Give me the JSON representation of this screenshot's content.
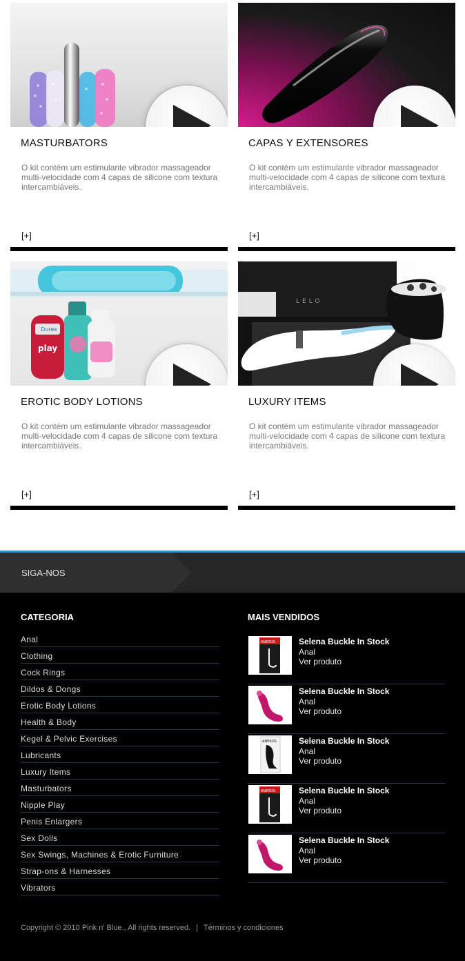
{
  "cards": [
    {
      "title": "MASTURBATORS",
      "description": "O kit contém um estimulante vibrador massageador multi-velocidade com 4 capas de silicone com textura intercambiáveis.",
      "more": "[+]"
    },
    {
      "title": "CAPAS Y EXTENSORES",
      "description": "O kit contém um estimulante vibrador massageador multi-velocidade com 4 capas de silicone com textura intercambiáveis.",
      "more": "[+]"
    },
    {
      "title": "EROTIC BODY LOTIONS",
      "description": "O kit contém um estimulante vibrador massageador multi-velocidade com 4 capas de silicone com textura intercambiáveis.",
      "more": "[+]"
    },
    {
      "title": "LUXURY ITEMS",
      "description": "O kit contém um estimulante vibrador massageador multi-velocidade com 4 capas de silicone com textura intercambiáveis.",
      "more": "[+]"
    }
  ],
  "image_labels": {
    "durex": "Durex",
    "play": "play",
    "lelo": "LELO",
    "aneros": "ANEROS"
  },
  "footer": {
    "follow_label": "SIGA-NOS",
    "category_heading": "CATEGORIA",
    "categories": [
      "Anal",
      "Clothing",
      "Cock Rings",
      "Dildos & Dongs",
      "Erotic Body Lotions",
      "Health & Body",
      "Kegel & Pelvic Exercises",
      "Lubricants",
      "Luxury Items",
      "Masturbators",
      "Nipple Play",
      "Penis Enlargers",
      "Sex Dolls",
      "Sex Swings, Machines & Erotic Furniture",
      "Strap-ons & Harnesses",
      "Vibrators"
    ],
    "bestsellers_heading": "MAIS VENDIDOS",
    "bestsellers": [
      {
        "name": "Selena Buckle In Stock",
        "category": "Anal",
        "link": "Ver produto"
      },
      {
        "name": "Selena Buckle In Stock",
        "category": "Anal",
        "link": "Ver produto"
      },
      {
        "name": "Selena Buckle In Stock",
        "category": "Anal",
        "link": "Ver produto"
      },
      {
        "name": "Selena Buckle In Stock",
        "category": "Anal",
        "link": "Ver produto"
      },
      {
        "name": "Selena Buckle In Stock",
        "category": "Anal",
        "link": "Ver produto"
      }
    ],
    "copyright": "Copyright © 2010 Pink n' Blue., All rights reserved.",
    "separator": "|",
    "terms_link": "Términos y condiciones"
  },
  "colors": {
    "accent_line": "#3a8fd0",
    "card_bar": "#000000",
    "footer_bg": "#000000",
    "follow_bg": "#262626",
    "list_divider": "#16355a"
  }
}
